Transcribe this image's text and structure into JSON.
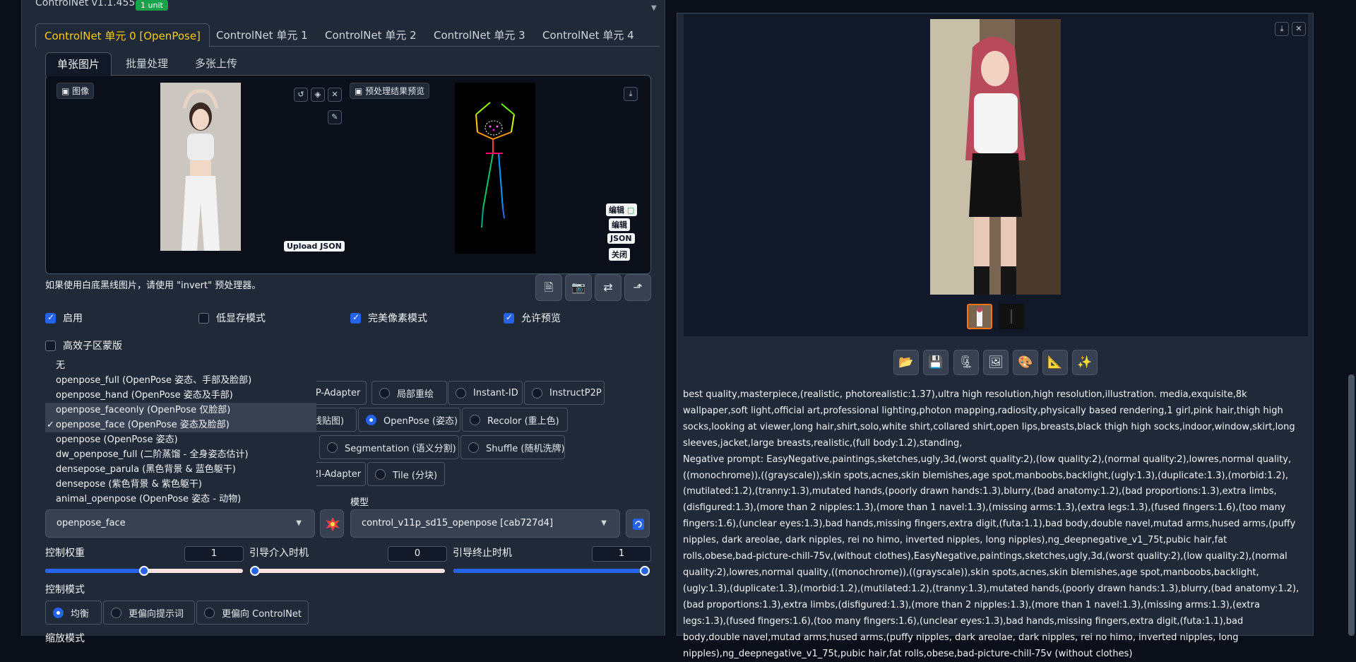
{
  "header": {
    "title": "ControlNet v1.1.455",
    "badge": "1 unit",
    "collapse_icon": "triangle-down-icon"
  },
  "unit_tabs": [
    {
      "label": "ControlNet 单元 0 [OpenPose]",
      "active": true
    },
    {
      "label": "ControlNet 单元 1",
      "active": false
    },
    {
      "label": "ControlNet 单元 2",
      "active": false
    },
    {
      "label": "ControlNet 单元 3",
      "active": false
    },
    {
      "label": "ControlNet 单元 4",
      "active": false
    }
  ],
  "sub_tabs": [
    {
      "label": "单张图片",
      "active": true
    },
    {
      "label": "批量处理",
      "active": false
    },
    {
      "label": "多张上传",
      "active": false
    }
  ],
  "image_panel": {
    "image_label": "图像",
    "preview_label": "预处理结果预览",
    "upload_json": "Upload JSON",
    "edit_label_1": "编辑",
    "edit_label_2": "编辑",
    "json_label": "JSON",
    "close_label": "关闭"
  },
  "hint": "如果使用白底黑线图片，请使用 \"invert\" 预处理器。",
  "checkboxes": {
    "enable": {
      "label": "启用",
      "checked": true
    },
    "low_vram": {
      "label": "低显存模式",
      "checked": false
    },
    "pixel_perfect": {
      "label": "完美像素模式",
      "checked": true
    },
    "allow_preview": {
      "label": "允许预览",
      "checked": true
    },
    "effective_region": {
      "label": "高效子区蒙版",
      "checked": false
    }
  },
  "dropdown_options": [
    {
      "label": "无",
      "selected": false
    },
    {
      "label": "openpose_full (OpenPose 姿态、手部及脸部)",
      "selected": false
    },
    {
      "label": "openpose_hand (OpenPose 姿态及手部)",
      "selected": false
    },
    {
      "label": "openpose_faceonly (OpenPose 仅脸部)",
      "selected": false
    },
    {
      "label": "openpose_face (OpenPose 姿态及脸部)",
      "selected": true
    },
    {
      "label": "openpose (OpenPose 姿态)",
      "selected": false
    },
    {
      "label": "dw_openpose_full (二阶蒸馏 - 全身姿态估计)",
      "selected": false
    },
    {
      "label": "densepose_parula (黑色背景 & 蓝色躯干)",
      "selected": false
    },
    {
      "label": "densepose (紫色背景 & 紫色躯干)",
      "selected": false
    },
    {
      "label": "animal_openpose (OpenPose 姿态 - 动物)",
      "selected": false
    }
  ],
  "control_types": {
    "row1": [
      "IP-Adapter",
      "局部重绘",
      "Instant-ID",
      "InstructP2P"
    ],
    "row2": [
      "线贴图)",
      "OpenPose (姿态)",
      "Recolor (重上色)"
    ],
    "row3": [
      "Segmentation (语义分割)",
      "Shuffle (随机洗牌)"
    ],
    "row4": [
      "2I-Adapter",
      "Tile (分块)"
    ],
    "selected": "OpenPose (姿态)"
  },
  "model": {
    "label": "模型",
    "preprocessor_value": "openpose_face",
    "model_value": "control_v11p_sd15_openpose [cab727d4]"
  },
  "sliders": {
    "weight": {
      "label": "控制权重",
      "value": "1",
      "fraction": 0.5
    },
    "start": {
      "label": "引导介入时机",
      "value": "0",
      "fraction": 0.0
    },
    "end": {
      "label": "引导终止时机",
      "value": "1",
      "fraction": 1.0
    }
  },
  "control_mode": {
    "label": "控制模式",
    "options": [
      "均衡",
      "更偏向提示词",
      "更偏向 ControlNet"
    ],
    "selected": "均衡"
  },
  "next_section_label": "缩放模式",
  "gallery_actions": [
    "folder-icon",
    "save-icon",
    "zip-icon",
    "image-icon",
    "palette-icon",
    "ruler-icon",
    "sparkle-icon"
  ],
  "prompt": "best quality,masterpiece,(realistic, photorealistic:1.37),ultra high resolution,high resolution,illustration. media,exquisite,8k wallpaper,soft light,official art,professional lighting,photon mapping,radiosity,physically based rendering,1 girl,pink hair,thigh high socks,looking at viewer,long hair,shirt,solo,white shirt,collared shirt,open lips,breasts,black thigh high socks,indoor,window,skirt,long sleeves,jacket,large breasts,realistic,(full body:1.2),standing,",
  "negative_prompt": "Negative prompt: EasyNegative,paintings,sketches,ugly,3d,(worst quality:2),(low quality:2),(normal quality:2),lowres,normal quality,((monochrome)),((grayscale)),skin spots,acnes,skin blemishes,age spot,manboobs,backlight,(ugly:1.3),(duplicate:1.3),(morbid:1.2),(mutilated:1.2),(tranny:1.3),mutated hands,(poorly drawn hands:1.3),blurry,(bad anatomy:1.2),(bad proportions:1.3),extra limbs,(disfigured:1.3),(more than 2 nipples:1.3),(more than 1 navel:1.3),(missing arms:1.3),(extra legs:1.3),(fused fingers:1.6),(too many fingers:1.6),(unclear eyes:1.3),bad hands,missing fingers,extra digit,(futa:1.1),bad body,double navel,mutad arms,hused arms,(puffy nipples, dark areolae, dark nipples, rei no himo, inverted nipples, long nipples),ng_deepnegative_v1_75t,pubic hair,fat rolls,obese,bad-picture-chill-75v,(without clothes),EasyNegative,paintings,sketches,ugly,3d,(worst quality:2),(low quality:2),(normal quality:2),lowres,normal quality,((monochrome)),((grayscale)),skin spots,acnes,skin blemishes,age spot,manboobs,backlight,(ugly:1.3),(duplicate:1.3),(morbid:1.2),(mutilated:1.2),(tranny:1.3),mutated hands,(poorly drawn hands:1.3),blurry,(bad anatomy:1.2),(bad proportions:1.3),extra limbs,(disfigured:1.3),(more than 2 nipples:1.3),(more than 1 navel:1.3),(missing arms:1.3),(extra legs:1.3),(fused fingers:1.6),(too many fingers:1.6),(unclear eyes:1.3),bad hands,missing fingers,extra digit,(futa:1.1),bad body,double navel,mutad arms,hused arms,(puffy nipples, dark areolae, dark nipples, rei no himo, inverted nipples, long nipples),ng_deepnegative_v1_75t,pubic hair,fat rolls,obese,bad-picture-chill-75v (without clothes)",
  "colors": {
    "accent": "#2563eb",
    "active_tab": "#facc15",
    "badge": "#16a34a",
    "thumb_border": "#f97316"
  }
}
